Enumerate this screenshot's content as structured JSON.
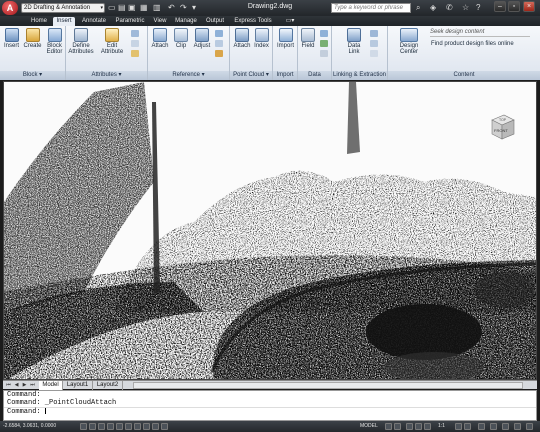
{
  "app": {
    "title": "Drawing2.dwg",
    "app_button_letter": "A",
    "workspace": "2D Drafting & Annotation",
    "help_search_placeholder": "Type a keyword or phrase",
    "accent": "#c3232a"
  },
  "tabs": [
    {
      "label": "Home",
      "active": false
    },
    {
      "label": "Insert",
      "active": true
    },
    {
      "label": "Annotate",
      "active": false
    },
    {
      "label": "Parametric",
      "active": false
    },
    {
      "label": "View",
      "active": false
    },
    {
      "label": "Manage",
      "active": false
    },
    {
      "label": "Output",
      "active": false
    },
    {
      "label": "Express Tools",
      "active": false
    }
  ],
  "ribbon": {
    "panels": [
      {
        "title": "Block",
        "buttons": [
          "Insert",
          "Create",
          "Block Editor"
        ]
      },
      {
        "title": "Attributes",
        "buttons": [
          "Define Attributes",
          "Edit Attribute"
        ]
      },
      {
        "title": "Reference",
        "buttons": [
          "Attach",
          "Clip",
          "Adjust"
        ]
      },
      {
        "title": "Point Cloud",
        "buttons": [
          "Attach",
          "Index"
        ]
      },
      {
        "title": "Import",
        "buttons": [
          "Import"
        ]
      },
      {
        "title": "Data",
        "buttons": [
          "Field"
        ]
      },
      {
        "title": "Linking & Extraction",
        "buttons": [
          "Data Link"
        ]
      },
      {
        "title": "Content",
        "buttons": [
          "Design Center"
        ]
      }
    ],
    "content": {
      "seek_placeholder": "Seek design content",
      "find_link": "Find product design files online"
    }
  },
  "viewcube": {
    "face": "FRONT",
    "top": "TOP"
  },
  "layout_tabs": [
    {
      "label": "Model",
      "active": true
    },
    {
      "label": "Layout1",
      "active": false
    },
    {
      "label": "Layout2",
      "active": false
    }
  ],
  "command_line": {
    "history": [
      "Command:",
      "Command: _PointCloudAttach"
    ],
    "prompt": "Command:"
  },
  "status_bar": {
    "coordinates": "-2.6584, 3.0631, 0.0000",
    "model_label": "MODEL",
    "scale": "1:1"
  }
}
